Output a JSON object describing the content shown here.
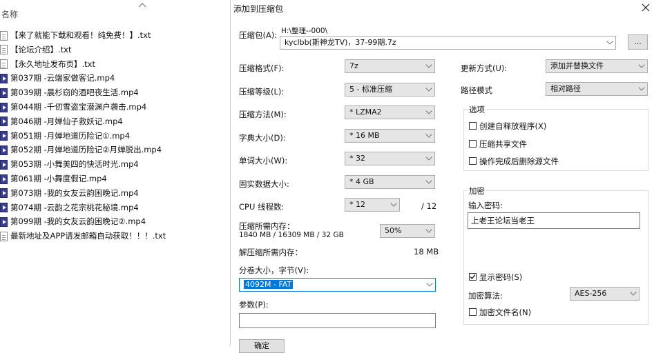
{
  "explorer": {
    "column_header": "名称",
    "files": [
      {
        "name": "【来了就能下载和观看！纯免费！】.txt",
        "type": "txt"
      },
      {
        "name": "【论坛介绍】.txt",
        "type": "txt"
      },
      {
        "name": "【永久地址发布页】.txt",
        "type": "txt"
      },
      {
        "name": "第037期 -云端家做客记.mp4",
        "type": "mp4"
      },
      {
        "name": "第039期 -晨杉窃的酒吧夜生活.mp4",
        "type": "mp4"
      },
      {
        "name": "第044期 -千仞雪盗宝潜渊户袭击.mp4",
        "type": "mp4"
      },
      {
        "name": "第046期 -月婵仙子救妖记.mp4",
        "type": "mp4"
      },
      {
        "name": "第051期 -月婵地道历险记①.mp4",
        "type": "mp4"
      },
      {
        "name": "第052期 -月婵地道历险记②月婵脱出.mp4",
        "type": "mp4"
      },
      {
        "name": "第053期 -小舞美四的快活时光.mp4",
        "type": "mp4"
      },
      {
        "name": "第061期 -小舞度假记.mp4",
        "type": "mp4"
      },
      {
        "name": "第073期 -我的女友云韵困晚记.mp4",
        "type": "mp4"
      },
      {
        "name": "第074期 -云韵之花宗桃花秘境.mp4",
        "type": "mp4"
      },
      {
        "name": "第099期 -我的女友云韵困晚记②.mp4",
        "type": "mp4"
      },
      {
        "name": "最新地址及APP请发邮箱自动获取！！！.txt",
        "type": "txt"
      }
    ]
  },
  "dialog": {
    "title": "添加到压缩包",
    "archive_label": "压缩包(A):",
    "archive_path": "H:\\整理--000\\",
    "archive_name": "kyclbb(斯神龙TV)，37-99期.7z",
    "browse_label": "...",
    "format_label": "压缩格式(F):",
    "format_value": "7z",
    "level_label": "压缩等级(L):",
    "level_value": "5 - 标准压缩",
    "method_label": "压缩方法(M):",
    "method_value": "* LZMA2",
    "dict_label": "字典大小(D):",
    "dict_value": "* 16 MB",
    "word_label": "单词大小(W):",
    "word_value": "* 32",
    "solid_label": "固实数据大小:",
    "solid_value": "* 4 GB",
    "threads_label": "CPU 线程数:",
    "threads_value": "* 12",
    "threads_total": "/ 12",
    "mem_comp_label": "压缩所需内存：",
    "mem_comp_detail": "1840 MB / 16309 MB / 32 GB",
    "mem_percent": "50%",
    "mem_decomp_label": "解压缩所需内存：",
    "mem_decomp_value": "18 MB",
    "split_label": "分卷大小，字节(V):",
    "split_value": "4092M - FAT",
    "params_label": "参数(P):",
    "params_value": "",
    "update_label": "更新方式(U):",
    "update_value": "添加并替换文件",
    "path_label": "路径模式",
    "path_value": "相对路径",
    "options_title": "选项",
    "opt_sfx": "创建自释放程序(X)",
    "opt_shared": "压缩共享文件",
    "opt_delete": "操作完成后删除源文件",
    "encrypt_title": "加密",
    "password_label": "输入密码:",
    "password_value": "上老王论坛当老王",
    "show_password": "显示密码(S)",
    "enc_method_label": "加密算法:",
    "enc_method_value": "AES-256",
    "encrypt_names": "加密文件名(N)",
    "ok_label": "确定"
  },
  "colors": {
    "selection": "#0078d7",
    "mp4_icon": "#3b3f8c"
  }
}
